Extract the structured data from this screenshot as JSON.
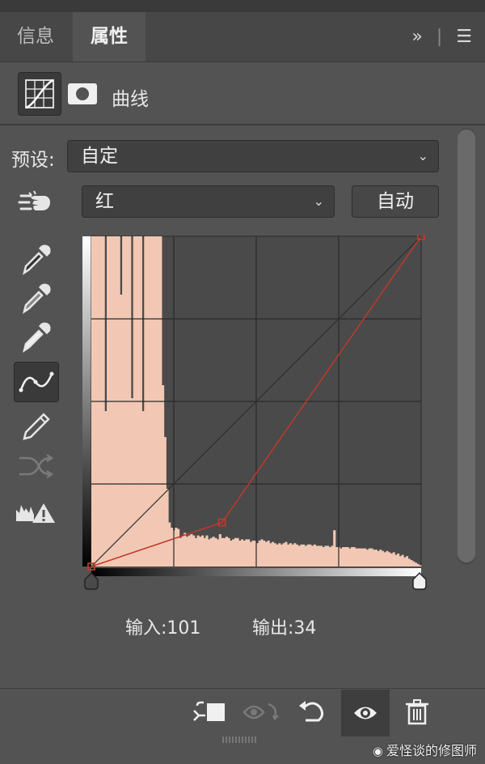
{
  "tabs": [
    {
      "label": "信息",
      "active": false
    },
    {
      "label": "属性",
      "active": true
    }
  ],
  "header": {
    "adjustment_title": "曲线"
  },
  "preset": {
    "label": "预设:",
    "value": "自定"
  },
  "channel": {
    "value": "红",
    "auto_label": "自动"
  },
  "readout": {
    "input_label": "输入:",
    "input_value": "101",
    "output_label": "输出:",
    "output_value": "34"
  },
  "curve": {
    "channel_color": "#c0382b",
    "points": [
      [
        0,
        0
      ],
      [
        101,
        34
      ],
      [
        255,
        255
      ]
    ],
    "histogram_color": "#f2c8b4"
  },
  "histogram": [
    255,
    255,
    255,
    255,
    255,
    255,
    120,
    255,
    255,
    255,
    255,
    255,
    255,
    210,
    255,
    255,
    255,
    255,
    130,
    255,
    255,
    255,
    255,
    120,
    255,
    255,
    255,
    255,
    255,
    255,
    255,
    255,
    140,
    100,
    60,
    34,
    30,
    28,
    30,
    29,
    22,
    24,
    26,
    23,
    24,
    25,
    24,
    22,
    24,
    23,
    24,
    22,
    24,
    21,
    22,
    23,
    22,
    21,
    25,
    22,
    22,
    23,
    22,
    20,
    21,
    22,
    22,
    20,
    21,
    20,
    21,
    21,
    19,
    20,
    20,
    18,
    20,
    21,
    20,
    19,
    20,
    18,
    19,
    18,
    17,
    18,
    17,
    18,
    19,
    17,
    18,
    17,
    18,
    17,
    16,
    17,
    17,
    16,
    17,
    17,
    16,
    17,
    16,
    16,
    16,
    15,
    16,
    16,
    15,
    16,
    28,
    15,
    15,
    14,
    15,
    15,
    15,
    14,
    15,
    15,
    14,
    14,
    14,
    14,
    14,
    13,
    14,
    14,
    13,
    13,
    12,
    13,
    12,
    11,
    12,
    11,
    10,
    11,
    9,
    10,
    8,
    9,
    7,
    8,
    6,
    5,
    4,
    3,
    2,
    1
  ],
  "colors": {
    "accent": "#c0382b",
    "panel": "#535353",
    "graph_bg": "#4a4a4a"
  },
  "icons": [
    "curves-adjustment-icon",
    "layer-mask-icon",
    "chevron-down-icon",
    "hand-target-icon",
    "eyedropper-black-icon",
    "eyedropper-gray-icon",
    "eyedropper-white-icon",
    "curve-edit-icon",
    "pencil-icon",
    "smooth-icon",
    "clipping-warning-icon",
    "clip-to-layer-icon",
    "view-previous-icon",
    "reset-icon",
    "visibility-icon",
    "trash-icon"
  ],
  "watermark": "爱怪谈的修图师"
}
